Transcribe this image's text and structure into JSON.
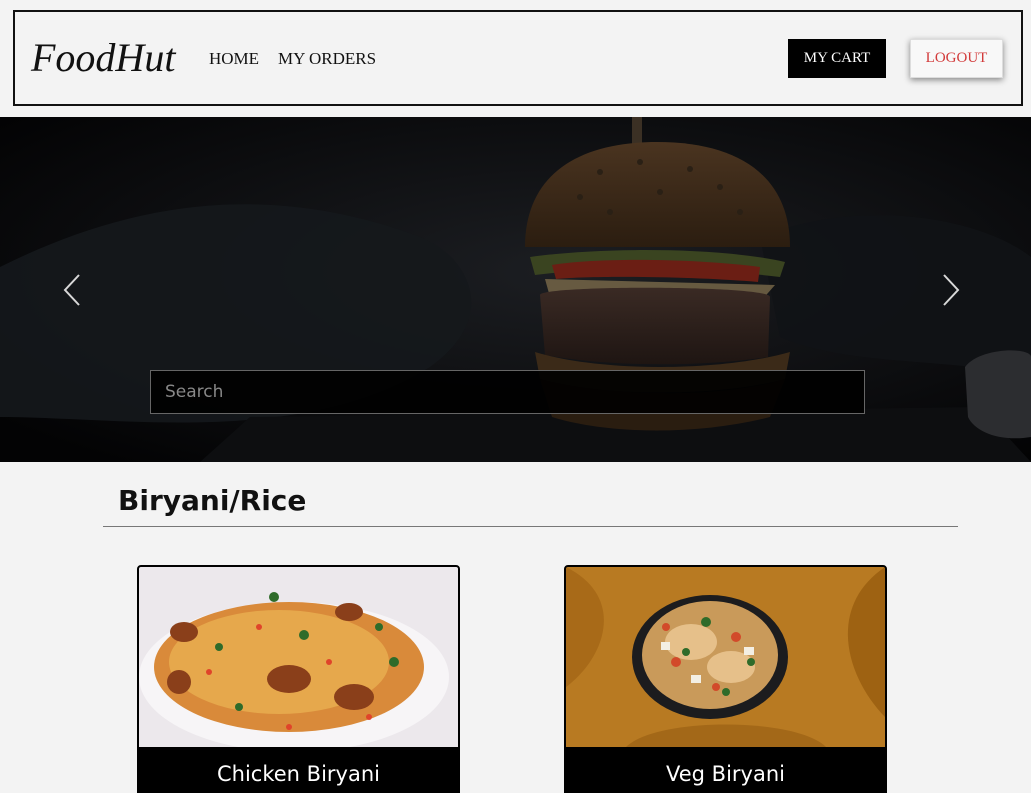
{
  "navbar": {
    "brand": "FoodHut",
    "links": [
      {
        "label": "HOME"
      },
      {
        "label": "MY ORDERS"
      }
    ],
    "cart_label": "MY CART",
    "logout_label": "LOGOUT"
  },
  "hero": {
    "search_placeholder": "Search",
    "prev_icon": "chevron-left-icon",
    "next_icon": "chevron-right-icon"
  },
  "category": {
    "title": "Biryani/Rice",
    "items": [
      {
        "name": "Chicken Biryani"
      },
      {
        "name": "Veg Biryani"
      }
    ]
  },
  "colors": {
    "accent_logout": "#d23a3a",
    "button_dark": "#000000",
    "background": "#f3f3f3"
  }
}
